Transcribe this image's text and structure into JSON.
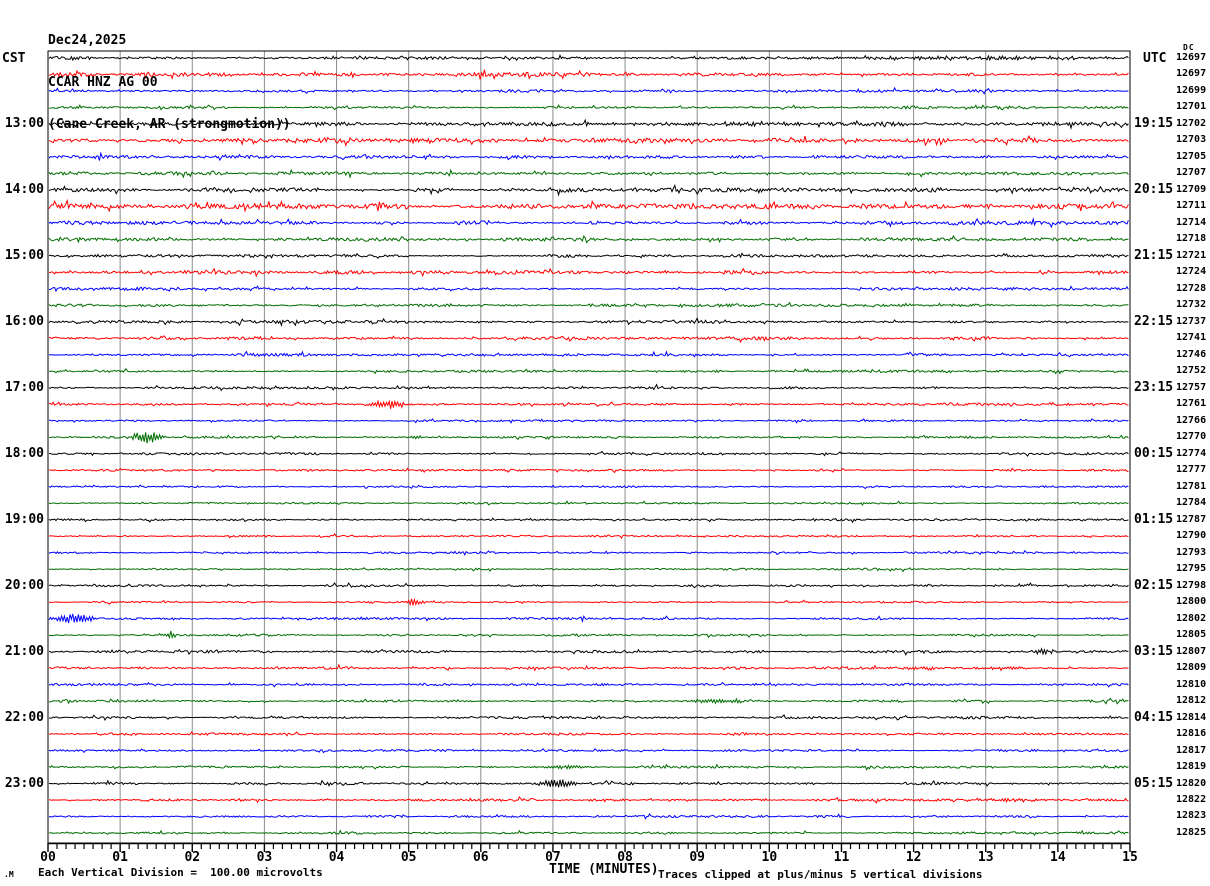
{
  "footer": {
    "division_note": "Each Vertical Division =  100.00 microvolts",
    "clip_note": "Traces clipped at plus/minus 5 vertical divisions",
    "corner_mark": ".M"
  },
  "chart_data": {
    "type": "line",
    "subtype": "helicorder-seismogram",
    "date": "Dec24,2025",
    "station": "CCAR HNZ AG 00",
    "location": "(Cane Creek, AR (strongmotion))",
    "left_axis": "CST",
    "right_axis": "UTC",
    "dc_header": "DC",
    "xlabel": "TIME (MINUTES)",
    "x_ticks": [
      "00",
      "01",
      "02",
      "03",
      "04",
      "05",
      "06",
      "07",
      "08",
      "09",
      "10",
      "11",
      "12",
      "13",
      "14",
      "15"
    ],
    "x_range_minutes": [
      0,
      15
    ],
    "minutes_per_line": 15,
    "minor_ticks_per_minute": 8,
    "grid": true,
    "grid_color": "#8c8c8c",
    "palette": {
      "k": "#000000",
      "r": "#ff0000",
      "b": "#0000ff",
      "g": "#006e00"
    },
    "rows": [
      {
        "dc": "12697",
        "color": "k",
        "cst": "",
        "utc": "",
        "noise": 0.9,
        "events": [
          [
            12.3,
            2.8,
            1.1
          ]
        ]
      },
      {
        "dc": "12697",
        "color": "r",
        "cst": "",
        "utc": "",
        "noise": 1.3,
        "events": []
      },
      {
        "dc": "12699",
        "color": "b",
        "cst": "",
        "utc": "",
        "noise": 0.9,
        "events": []
      },
      {
        "dc": "12701",
        "color": "g",
        "cst": "",
        "utc": "",
        "noise": 0.9,
        "events": []
      },
      {
        "dc": "12702",
        "color": "k",
        "cst": "13:00",
        "utc": "19:15",
        "noise": 1.1,
        "events": [
          [
            9.5,
            3.0,
            0.9
          ]
        ]
      },
      {
        "dc": "12703",
        "color": "r",
        "cst": "",
        "utc": "",
        "noise": 1.4,
        "events": [
          [
            3.5,
            3.5,
            0.7
          ]
        ]
      },
      {
        "dc": "12705",
        "color": "b",
        "cst": "",
        "utc": "",
        "noise": 1.0,
        "events": []
      },
      {
        "dc": "12707",
        "color": "g",
        "cst": "",
        "utc": "",
        "noise": 1.0,
        "events": []
      },
      {
        "dc": "12709",
        "color": "k",
        "cst": "14:00",
        "utc": "20:15",
        "noise": 1.3,
        "events": []
      },
      {
        "dc": "12711",
        "color": "r",
        "cst": "",
        "utc": "",
        "noise": 1.8,
        "events": []
      },
      {
        "dc": "12714",
        "color": "b",
        "cst": "",
        "utc": "",
        "noise": 1.2,
        "events": []
      },
      {
        "dc": "12718",
        "color": "g",
        "cst": "",
        "utc": "",
        "noise": 1.1,
        "events": []
      },
      {
        "dc": "12721",
        "color": "k",
        "cst": "15:00",
        "utc": "21:15",
        "noise": 0.9,
        "events": []
      },
      {
        "dc": "12724",
        "color": "r",
        "cst": "",
        "utc": "",
        "noise": 1.2,
        "events": []
      },
      {
        "dc": "12728",
        "color": "b",
        "cst": "",
        "utc": "",
        "noise": 0.9,
        "events": []
      },
      {
        "dc": "12732",
        "color": "g",
        "cst": "",
        "utc": "",
        "noise": 0.9,
        "events": []
      },
      {
        "dc": "12737",
        "color": "k",
        "cst": "16:00",
        "utc": "22:15",
        "noise": 1.0,
        "events": []
      },
      {
        "dc": "12741",
        "color": "r",
        "cst": "",
        "utc": "",
        "noise": 1.1,
        "events": []
      },
      {
        "dc": "12746",
        "color": "b",
        "cst": "",
        "utc": "",
        "noise": 0.9,
        "events": []
      },
      {
        "dc": "12752",
        "color": "g",
        "cst": "",
        "utc": "",
        "noise": 0.9,
        "events": []
      },
      {
        "dc": "12757",
        "color": "k",
        "cst": "17:00",
        "utc": "23:15",
        "noise": 0.8,
        "events": []
      },
      {
        "dc": "12761",
        "color": "r",
        "cst": "",
        "utc": "",
        "noise": 0.7,
        "events": [
          [
            4.72,
            0.22,
            4.5
          ]
        ]
      },
      {
        "dc": "12766",
        "color": "b",
        "cst": "",
        "utc": "",
        "noise": 0.6,
        "events": []
      },
      {
        "dc": "12770",
        "color": "g",
        "cst": "",
        "utc": "",
        "noise": 0.7,
        "events": [
          [
            1.37,
            0.18,
            7.0
          ],
          [
            5.1,
            0.12,
            1.6
          ]
        ]
      },
      {
        "dc": "12774",
        "color": "k",
        "cst": "18:00",
        "utc": "00:15",
        "noise": 0.7,
        "events": []
      },
      {
        "dc": "12777",
        "color": "r",
        "cst": "",
        "utc": "",
        "noise": 0.6,
        "events": []
      },
      {
        "dc": "12781",
        "color": "b",
        "cst": "",
        "utc": "",
        "noise": 0.6,
        "events": []
      },
      {
        "dc": "12784",
        "color": "g",
        "cst": "",
        "utc": "",
        "noise": 0.6,
        "events": []
      },
      {
        "dc": "12787",
        "color": "k",
        "cst": "19:00",
        "utc": "01:15",
        "noise": 0.7,
        "events": []
      },
      {
        "dc": "12790",
        "color": "r",
        "cst": "",
        "utc": "",
        "noise": 0.6,
        "events": []
      },
      {
        "dc": "12793",
        "color": "b",
        "cst": "",
        "utc": "",
        "noise": 0.6,
        "events": []
      },
      {
        "dc": "12795",
        "color": "g",
        "cst": "",
        "utc": "",
        "noise": 0.6,
        "events": []
      },
      {
        "dc": "12798",
        "color": "k",
        "cst": "20:00",
        "utc": "02:15",
        "noise": 0.7,
        "events": [
          [
            13.52,
            0.1,
            1.8
          ]
        ]
      },
      {
        "dc": "12800",
        "color": "r",
        "cst": "",
        "utc": "",
        "noise": 0.6,
        "events": [
          [
            5.08,
            0.1,
            4.5
          ]
        ]
      },
      {
        "dc": "12802",
        "color": "b",
        "cst": "",
        "utc": "",
        "noise": 0.7,
        "events": [
          [
            0.38,
            0.28,
            4.5
          ]
        ]
      },
      {
        "dc": "12805",
        "color": "g",
        "cst": "",
        "utc": "",
        "noise": 0.7,
        "events": [
          [
            1.7,
            0.1,
            3.0
          ]
        ]
      },
      {
        "dc": "12807",
        "color": "k",
        "cst": "21:00",
        "utc": "03:15",
        "noise": 0.8,
        "events": [
          [
            13.78,
            0.09,
            3.2
          ]
        ]
      },
      {
        "dc": "12809",
        "color": "r",
        "cst": "",
        "utc": "",
        "noise": 0.8,
        "events": [
          [
            12.1,
            0.25,
            1.5
          ],
          [
            13.3,
            0.3,
            1.4
          ]
        ]
      },
      {
        "dc": "12810",
        "color": "b",
        "cst": "",
        "utc": "",
        "noise": 0.7,
        "events": []
      },
      {
        "dc": "12812",
        "color": "g",
        "cst": "",
        "utc": "",
        "noise": 0.7,
        "events": [
          [
            9.25,
            0.4,
            2.2
          ]
        ]
      },
      {
        "dc": "12814",
        "color": "k",
        "cst": "22:00",
        "utc": "04:15",
        "noise": 0.8,
        "events": []
      },
      {
        "dc": "12816",
        "color": "r",
        "cst": "",
        "utc": "",
        "noise": 0.8,
        "events": []
      },
      {
        "dc": "12817",
        "color": "b",
        "cst": "",
        "utc": "",
        "noise": 0.7,
        "events": []
      },
      {
        "dc": "12819",
        "color": "g",
        "cst": "",
        "utc": "",
        "noise": 0.7,
        "events": [
          [
            7.15,
            0.35,
            1.6
          ]
        ]
      },
      {
        "dc": "12820",
        "color": "k",
        "cst": "23:00",
        "utc": "05:15",
        "noise": 0.8,
        "events": [
          [
            7.07,
            0.22,
            4.5
          ]
        ]
      },
      {
        "dc": "12822",
        "color": "r",
        "cst": "",
        "utc": "",
        "noise": 0.8,
        "events": [
          [
            13.2,
            0.5,
            1.0
          ]
        ]
      },
      {
        "dc": "12823",
        "color": "b",
        "cst": "",
        "utc": "",
        "noise": 0.7,
        "events": []
      },
      {
        "dc": "12825",
        "color": "g",
        "cst": "",
        "utc": "",
        "noise": 0.7,
        "events": []
      }
    ]
  }
}
